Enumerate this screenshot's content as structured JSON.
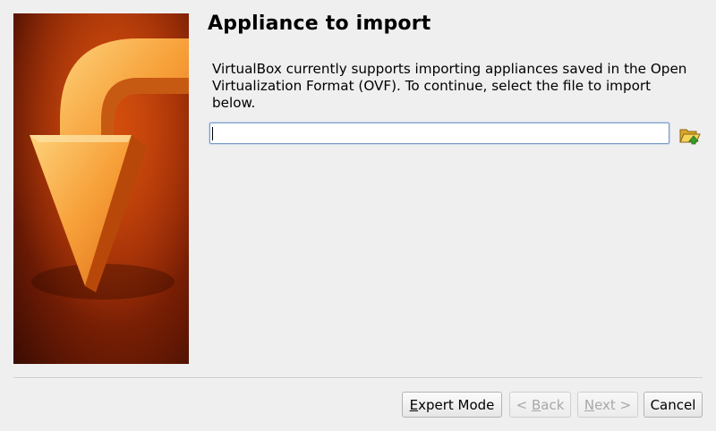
{
  "page": {
    "title": "Appliance to import",
    "description": "VirtualBox currently supports importing appliances saved in the Open Virtualization Format (OVF). To continue, select the file to import below."
  },
  "file_input": {
    "value": "",
    "placeholder": ""
  },
  "browse_button": {
    "icon": "folder-open-icon"
  },
  "buttons": {
    "expert_mode": {
      "mnemonic": "E",
      "rest": "xpert Mode"
    },
    "back": {
      "prefix": "< ",
      "mnemonic": "B",
      "rest": "ack",
      "enabled": false
    },
    "next": {
      "mnemonic": "N",
      "rest": "ext >",
      "enabled": false
    },
    "cancel": {
      "label": "Cancel"
    }
  },
  "colors": {
    "banner_dark": "#3a0c02",
    "banner_mid": "#9a2a06",
    "arrow_orange": "#f6921e",
    "arrow_light": "#fcc46a",
    "focus_border": "#7a9cc6"
  }
}
